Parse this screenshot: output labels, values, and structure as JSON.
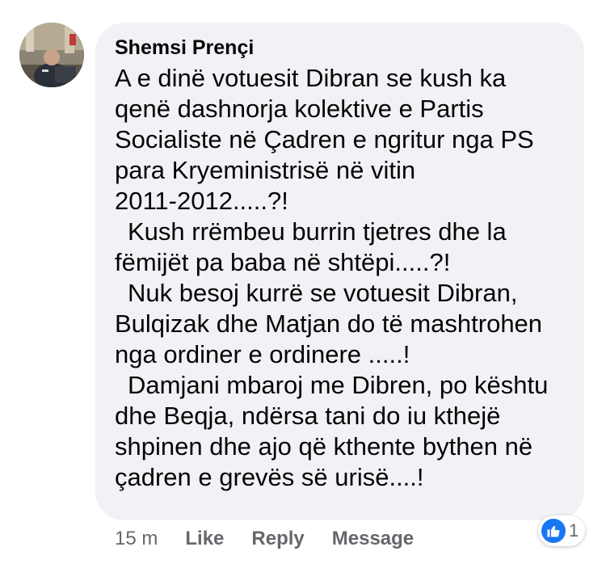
{
  "comment": {
    "author": "Shemsi Prençi",
    "paragraphs": [
      {
        "text": "A e dinë votuesit Dibran se kush ka\nqenë dashnorja kolektive e Partis\nSocialiste në Çadren e ngritur nga PS\npara Kryeministrisë në vitin\n2011-2012.....?!",
        "indent": false
      },
      {
        "text": "Kush rrëmbeu burrin tjetres dhe la\nfëmijët pa baba në shtëpi.....?!",
        "indent": true
      },
      {
        "text": "Nuk besoj kurrë se votuesit Dibran,\nBulqizak dhe Matjan do të mashtrohen\nnga ordiner e ordinere .....!",
        "indent": true
      },
      {
        "text": "Damjani mbaroj me Dibren, po kështu\ndhe Beqja, ndërsa tani do iu kthejë\nshpinen dhe ajo që kthente bythen në\nçadren e grevës së urisë....!",
        "indent": true
      }
    ]
  },
  "actions": {
    "time": "15 m",
    "like": "Like",
    "reply": "Reply",
    "message": "Message"
  },
  "reactions": {
    "icon": "like-icon",
    "count": "1"
  },
  "colors": {
    "bubble": "#f0f2f5",
    "text": "#050505",
    "secondary": "#65676b",
    "like_blue": "#1877f2"
  }
}
